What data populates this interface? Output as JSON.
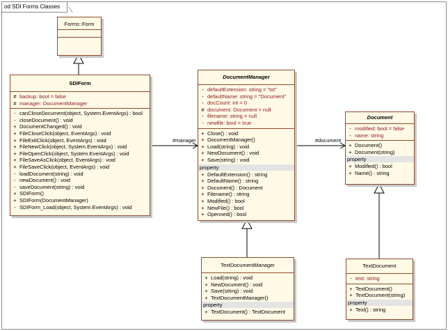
{
  "frame_title": "od SDI Forms Classes",
  "classes": {
    "form": {
      "name": "Forms::Form"
    },
    "sdiform": {
      "name": "SDIForm",
      "attributes": [
        {
          "vis": "#",
          "text": "backup:  bool = false"
        },
        {
          "vis": "#",
          "text": "manager:  DocumentManager"
        }
      ],
      "operations": [
        {
          "vis": "-",
          "text": "canCloseDocument(object, System.EventArgs) : bool"
        },
        {
          "vis": "-",
          "text": "closeDocument() : void"
        },
        {
          "vis": "+",
          "text": "DocumentChanged() : void"
        },
        {
          "vis": "+",
          "text": "FileCloseClick(object, EventArgs) : void"
        },
        {
          "vis": "+",
          "text": "FileExitClick(object, EventArgs) : void"
        },
        {
          "vis": "+",
          "text": "FileNewClick(object, System.EventArgs) : void"
        },
        {
          "vis": "+",
          "text": "FileOpenClick(object, System.EventArgs) : void"
        },
        {
          "vis": "+",
          "text": "FileSaveAsClick(object, EventArgs) : void"
        },
        {
          "vis": "+",
          "text": "FileSaveClick(object, EventArgs) : void"
        },
        {
          "vis": "-",
          "text": "loadDocument(string) : void"
        },
        {
          "vis": "-",
          "text": "newDocument() : void"
        },
        {
          "vis": "-",
          "text": "saveDocument(string) : void"
        },
        {
          "vis": "+",
          "text": "SDIForm()"
        },
        {
          "vis": "+",
          "text": "SDIForm(DocumentManager)"
        },
        {
          "vis": "-",
          "text": "SDIForm_Load(object, System.EventArgs) : void"
        }
      ]
    },
    "docmanager": {
      "name": "DocumentManager",
      "attributes": [
        {
          "vis": "-",
          "text": "defaultExtension:  string = \"txt\""
        },
        {
          "vis": "-",
          "text": "defaultName:  string = \"Document\""
        },
        {
          "vis": "-",
          "text": "docCount:  int = 0"
        },
        {
          "vis": "#",
          "text": "document:  Document = null"
        },
        {
          "vis": "-",
          "text": "filename:  string = null"
        },
        {
          "vis": "-",
          "text": "newfile:  bool = true"
        }
      ],
      "operations": [
        {
          "vis": "+",
          "text": "Close() : void"
        },
        {
          "vis": "+",
          "text": "DocumentManager()"
        },
        {
          "vis": "+",
          "text": "Load(string) : void"
        },
        {
          "vis": "+",
          "text": "NewDocument() : void"
        },
        {
          "vis": "+",
          "text": "Save(string) : void"
        }
      ],
      "property_label": "property",
      "properties": [
        {
          "vis": "+",
          "text": "DefaultExtension() : string"
        },
        {
          "vis": "+",
          "text": "DefaultName() : string"
        },
        {
          "vis": "+",
          "text": "Document() : Document"
        },
        {
          "vis": "+",
          "text": "Filename() : string"
        },
        {
          "vis": "+",
          "text": "Modified() : bool"
        },
        {
          "vis": "+",
          "text": "NewFile() : bool"
        },
        {
          "vis": "+",
          "text": "Openned() : bool"
        }
      ]
    },
    "document": {
      "name": "Document",
      "attributes": [
        {
          "vis": "-",
          "text": "modified:  bool = false"
        },
        {
          "vis": "-",
          "text": "name:  string"
        }
      ],
      "operations": [
        {
          "vis": "+",
          "text": "Document()"
        },
        {
          "vis": "+",
          "text": "Document(string)"
        }
      ],
      "property_label": "property",
      "properties": [
        {
          "vis": "+",
          "text": "Modified() : bool"
        },
        {
          "vis": "+",
          "text": "Name() : string"
        }
      ]
    },
    "textdocmanager": {
      "name": "TextDocumentManager",
      "operations": [
        {
          "vis": "+",
          "text": "Load(string) : void"
        },
        {
          "vis": "+",
          "text": "NewDocument() : void"
        },
        {
          "vis": "+",
          "text": "Save(string) : void"
        },
        {
          "vis": "+",
          "text": "TextDocumentManager()"
        }
      ],
      "property_label": "property",
      "properties": [
        {
          "vis": "+",
          "text": "TextDocument() : TextDocument"
        }
      ]
    },
    "textdocument": {
      "name": "TextDocument",
      "attributes": [
        {
          "vis": "-",
          "text": "text:  string"
        }
      ],
      "operations": [
        {
          "vis": "+",
          "text": "TextDocument()"
        },
        {
          "vis": "+",
          "text": "TextDocument(string)"
        }
      ],
      "property_label": "property",
      "properties": [
        {
          "vis": "+",
          "text": "Text() : string"
        }
      ]
    }
  },
  "associations": {
    "manager_label": "#manager",
    "document_label": "#document"
  },
  "colors": {
    "class_fill": "#fff9e6",
    "class_border": "#8b4a2b",
    "attribute_text": "#8b1a1a"
  }
}
